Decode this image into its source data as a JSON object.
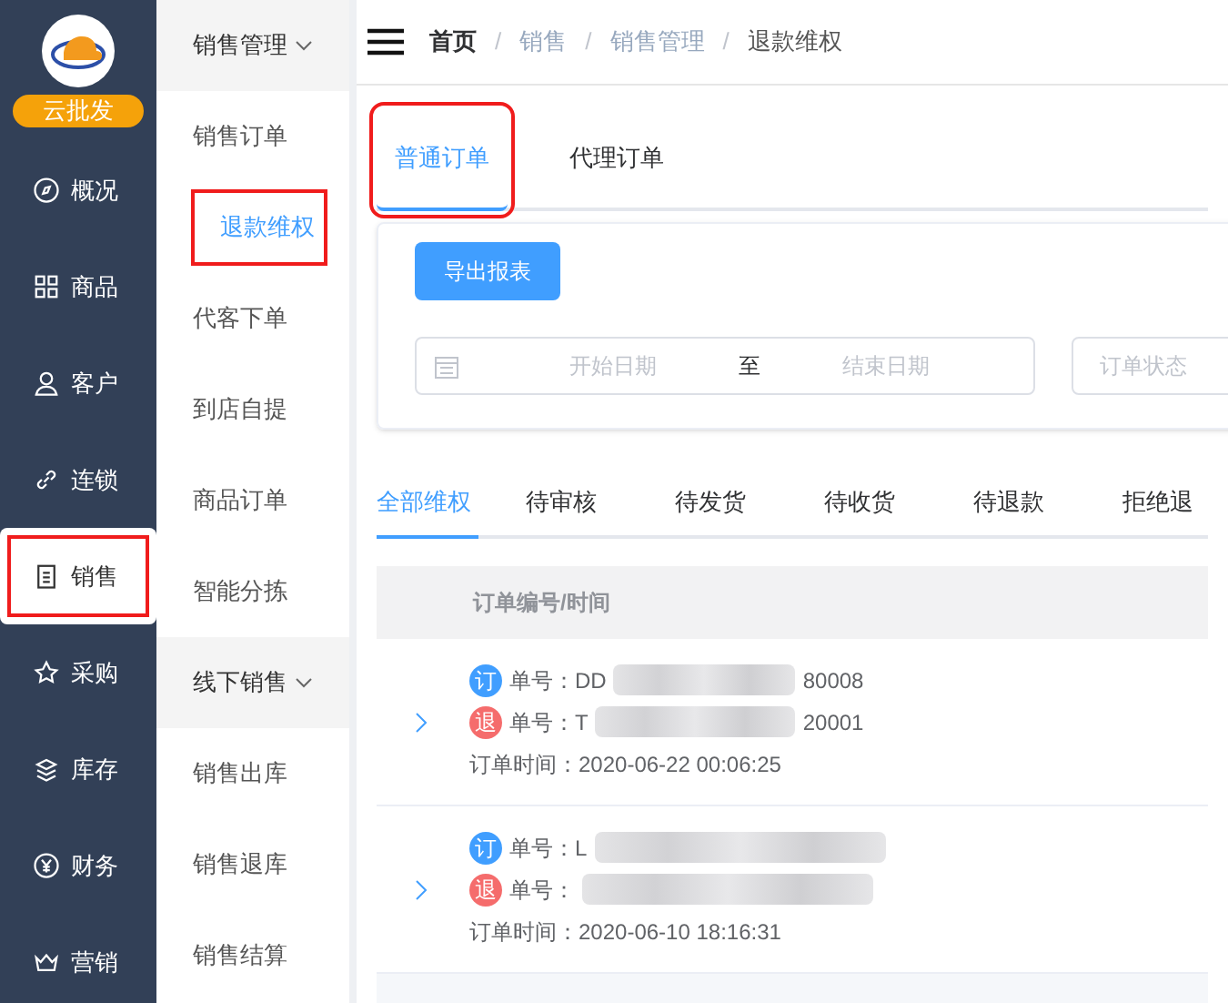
{
  "logo": {
    "badge": "云批发"
  },
  "nav": [
    {
      "label": "概况",
      "selected": false,
      "highlighted": false
    },
    {
      "label": "商品",
      "selected": false,
      "highlighted": false
    },
    {
      "label": "客户",
      "selected": false,
      "highlighted": false
    },
    {
      "label": "连锁",
      "selected": false,
      "highlighted": false
    },
    {
      "label": "销售",
      "selected": true,
      "highlighted": true
    },
    {
      "label": "采购",
      "selected": false,
      "highlighted": false
    },
    {
      "label": "库存",
      "selected": false,
      "highlighted": false
    },
    {
      "label": "财务",
      "selected": false,
      "highlighted": false
    },
    {
      "label": "营销",
      "selected": false,
      "highlighted": false
    }
  ],
  "submenu": [
    {
      "title": "销售管理",
      "expanded": true,
      "children": [
        {
          "label": "销售订单",
          "selected": false,
          "highlighted": false
        },
        {
          "label": "退款维权",
          "selected": true,
          "highlighted": true
        },
        {
          "label": "代客下单",
          "selected": false,
          "highlighted": false
        },
        {
          "label": "到店自提",
          "selected": false,
          "highlighted": false
        },
        {
          "label": "商品订单",
          "selected": false,
          "highlighted": false
        },
        {
          "label": "智能分拣",
          "selected": false,
          "highlighted": false
        }
      ]
    },
    {
      "title": "线下销售",
      "expanded": true,
      "children": [
        {
          "label": "销售出库",
          "selected": false,
          "highlighted": false
        },
        {
          "label": "销售退库",
          "selected": false,
          "highlighted": false
        },
        {
          "label": "销售结算",
          "selected": false,
          "highlighted": false
        }
      ]
    }
  ],
  "breadcrumb": [
    {
      "label": "首页",
      "kind": "link"
    },
    {
      "label": "销售",
      "kind": "muted"
    },
    {
      "label": "销售管理",
      "kind": "muted"
    },
    {
      "label": "退款维权",
      "kind": "current"
    }
  ],
  "breadcrumb_separator": "/",
  "order_tabs": [
    {
      "label": "普通订单",
      "selected": true,
      "highlighted": true
    },
    {
      "label": "代理订单",
      "selected": false,
      "highlighted": false
    }
  ],
  "filters": {
    "export_button": "导出报表",
    "start_placeholder": "开始日期",
    "range_separator": "至",
    "end_placeholder": "结束日期",
    "status_placeholder": "订单状态"
  },
  "status_tabs": [
    {
      "label": "全部维权",
      "selected": true
    },
    {
      "label": "待审核",
      "selected": false
    },
    {
      "label": "待发货",
      "selected": false
    },
    {
      "label": "待收货",
      "selected": false
    },
    {
      "label": "待退款",
      "selected": false
    },
    {
      "label": "拒绝退",
      "selected": false
    }
  ],
  "table": {
    "columns": [
      "订单编号/时间"
    ],
    "rows": [
      {
        "order_badge": "订",
        "order_label": "单号：",
        "order_start": "DD",
        "order_end": "80008",
        "refund_badge": "退",
        "refund_label": "单号：",
        "refund_start": "T",
        "refund_end": "20001",
        "time": "订单时间：2020-06-22 00:06:25"
      },
      {
        "order_badge": "订",
        "order_label": "单号：",
        "order_start": "L",
        "order_end": "",
        "refund_badge": "退",
        "refund_label": "单号：",
        "refund_start": "",
        "refund_end": "",
        "time": "订单时间：2020-06-10 18:16:31"
      }
    ]
  }
}
